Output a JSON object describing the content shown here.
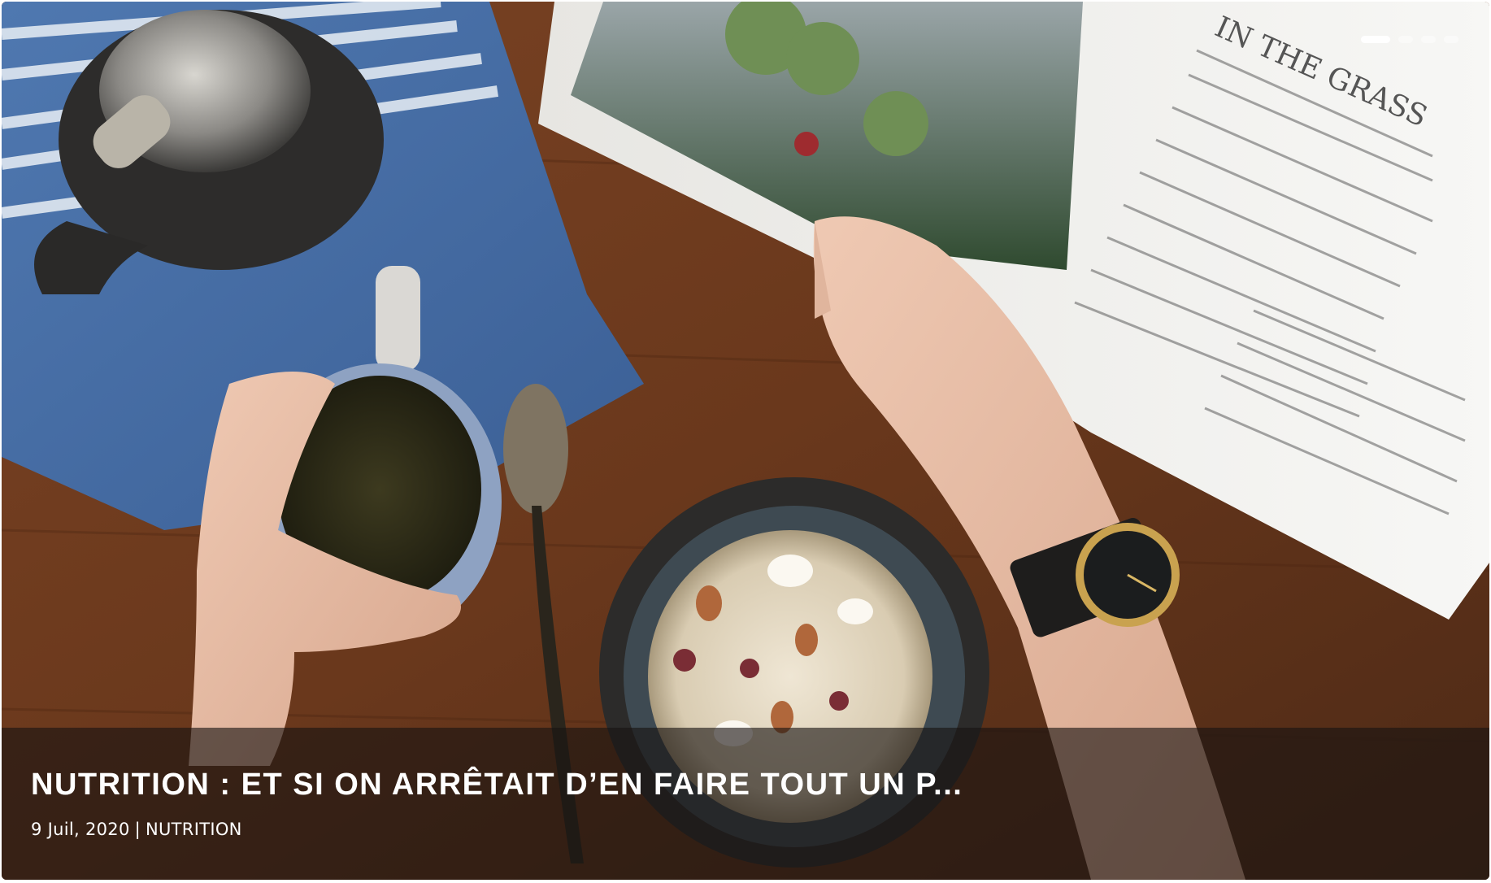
{
  "slide": {
    "title": "NUTRITION : ET SI ON ARRÊTAIT D’EN FAIRE TOUT UN P...",
    "date": "9 Juil, 2020",
    "separator": "|",
    "category": "NUTRITION",
    "image_alt": "Breakfast table with tea, granola bowl and magazine"
  },
  "slider": {
    "slide_count": 4,
    "active_index": 0
  },
  "colors": {
    "overlay": "#181412",
    "caption_text": "#ffffff",
    "dot_active": "#ffffff",
    "table_wood": "#6b3a1f"
  },
  "icons": {
    "slide_indicator": "pill-dot"
  }
}
